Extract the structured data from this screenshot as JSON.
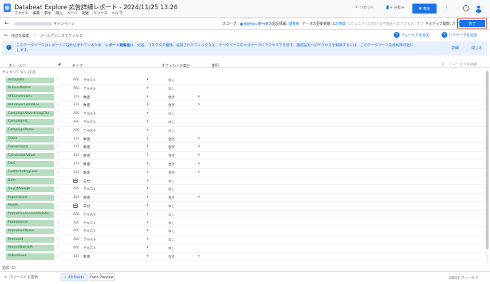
{
  "header": {
    "title": "Databeat Explore 広告詳細レポート - 2024/11/25 13:26",
    "menu": [
      "ファイル",
      "編集",
      "表示",
      "挿入",
      "ページ",
      "配置",
      "リソース",
      "ヘルプ"
    ],
    "reset_label": "リセット",
    "share_label": "共有",
    "view_label": "表示"
  },
  "datasource_bar": {
    "name_suffix": "キャンペーン",
    "scope_label": "スコープ:",
    "scope_chip": "■ 使用中のレポート",
    "credentials_label": "データの認証情報:",
    "credentials_value": "閲覧者",
    "freshness_label": "データの更新頻度:",
    "freshness_value": "12 時間",
    "community_text": "コミュニティにおける可視化へのアクセス: オフ",
    "native_text": "ネイティブ関数: オフ",
    "finish_label": "完了"
  },
  "subbar": {
    "back_label": "接続を編集",
    "separator": "›",
    "filter_label": "メールアドレスでフィルタ",
    "add_field_label": "フィールドを追加",
    "add_param_label": "パラメータを追加"
  },
  "banner": {
    "line1_pre": "このデータソースはレポートに埋め込まれているため、",
    "line1_bold": "レポート閲覧者",
    "line1_post": "は、列名、コネクタの種類、追加されたフィルタなど、データソースのメタデータにアクセスできます。接続設定へのアクセスを制限するには、このデータソースを再利用可能に",
    "line2": "します。",
    "detail_label": "詳細",
    "close_label": "閉じる"
  },
  "columns": {
    "field": "フィールド",
    "type": "タイプ",
    "default_agg": "デフォルトの集計",
    "description": "説明",
    "search_placeholder": "フィールドを検索"
  },
  "sections": {
    "dimensions": "ディメンション (22)",
    "metrics": "指標 (1)"
  },
  "rows": [
    {
      "name": "AccountId",
      "icon": "ABC",
      "type": "テキスト",
      "agg": "なし",
      "agg_caret": false
    },
    {
      "name": "AccountName",
      "icon": "ABC",
      "type": "テキスト",
      "agg": "なし",
      "agg_caret": false
    },
    {
      "name": "AllConversions",
      "icon": "123",
      "type": "数値",
      "agg": "合計",
      "agg_caret": true
    },
    {
      "name": "AllConversionValue",
      "icon": "123",
      "type": "数値",
      "agg": "合計",
      "agg_caret": true
    },
    {
      "name": "CampaignAdvertisingCha...",
      "icon": "ABC",
      "type": "テキスト",
      "agg": "なし",
      "agg_caret": false
    },
    {
      "name": "CampaignId_",
      "icon": "ABC",
      "type": "テキスト",
      "agg": "なし",
      "agg_caret": false
    },
    {
      "name": "CampaignName",
      "icon": "ABC",
      "type": "テキスト",
      "agg": "なし",
      "agg_caret": false
    },
    {
      "name": "Clicks",
      "icon": "123",
      "type": "数値",
      "agg": "合計",
      "agg_caret": true
    },
    {
      "name": "Conversions",
      "icon": "123",
      "type": "数値",
      "agg": "合計",
      "agg_caret": true
    },
    {
      "name": "ConversionValue",
      "icon": "123",
      "type": "数値",
      "agg": "合計",
      "agg_caret": true
    },
    {
      "name": "Cost",
      "icon": "123",
      "type": "数値",
      "agg": "合計",
      "agg_caret": true
    },
    {
      "name": "CostIncludingFees",
      "icon": "123",
      "type": "数値",
      "agg": "合計",
      "agg_caret": true
    },
    {
      "name": "Date",
      "icon": "calendar",
      "type": "日付",
      "agg": "なし",
      "agg_caret": false
    },
    {
      "name": "DayOfWeekJA",
      "icon": "ABC",
      "type": "テキスト",
      "agg": "なし",
      "agg_caret": false
    },
    {
      "name": "Impressions",
      "icon": "123",
      "type": "数値",
      "agg": "合計",
      "agg_caret": true
    },
    {
      "name": "Month_",
      "icon": "calendar",
      "type": "日付",
      "agg": "なし",
      "agg_caret": false
    },
    {
      "name": "PromotionAccountRelatio...",
      "icon": "ABC",
      "type": "テキスト",
      "agg": "なし",
      "agg_caret": false
    },
    {
      "name": "PromotionId",
      "icon": "ABC",
      "type": "テキスト",
      "agg": "なし",
      "agg_caret": false
    },
    {
      "name": "PromotionName",
      "icon": "ABC",
      "type": "テキスト",
      "agg": "なし",
      "agg_caret": false
    },
    {
      "name": "ServiceId",
      "icon": "ABC",
      "type": "テキスト",
      "agg": "なし",
      "agg_caret": false
    },
    {
      "name": "ServiceNameJA",
      "icon": "ABC",
      "type": "テキスト",
      "agg": "なし",
      "agg_caret": false
    },
    {
      "name": "VideoViews",
      "icon": "123",
      "type": "数値",
      "agg": "合計",
      "agg_caret": true
    }
  ],
  "bottom": {
    "refresh_label": "フィールドを更新",
    "tab_all": "All Fields",
    "tab_preview": "Data Preview",
    "count": "23/23 フィールド"
  },
  "colors": {
    "accent": "#1a73e8",
    "dimension_pill": "#b7dcc0",
    "banner_bg": "#e8f0fe"
  }
}
